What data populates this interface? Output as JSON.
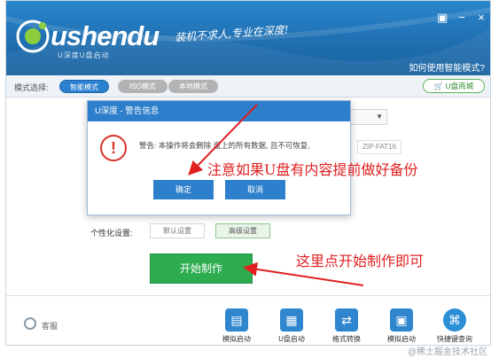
{
  "header": {
    "logo_text": "ushendu",
    "logo_sub": "U深度U盘启动",
    "slogan": "装机不求人,专业在深度!",
    "help_link": "如何使用智能模式?",
    "window_controls": [
      "skin-icon",
      "minimize-icon",
      "close-icon"
    ]
  },
  "mode_bar": {
    "label": "模式选择:",
    "modes": [
      "智能模式",
      "ISO模式",
      "本地模式"
    ],
    "shop_label": "U盘商城"
  },
  "content": {
    "fs_value": "ZIP-FAT16",
    "personal_label": "个性化设置:",
    "default_label": "默认设置",
    "advanced_label": "高级设置",
    "start_label": "开始制作"
  },
  "dialog": {
    "title": "U深度 - 警告信息",
    "message": "警告: 本操作将会删除 盘上的所有数据, 且不可恢复,",
    "ok_label": "确定",
    "cancel_label": "取消"
  },
  "annotations": {
    "note_1": "注意如果U盘有内容提前做好备份",
    "note_2": "这里点开始制作即可"
  },
  "bottom_bar": {
    "service_label": "客服",
    "tools": [
      "模拟启动",
      "U盘启动",
      "格式转换",
      "模拟启动",
      "快捷键查询"
    ]
  },
  "watermark": "@稀土掘金技术社区",
  "colors": {
    "header_blue": "#1f6fb1",
    "accent_blue": "#2d7ecb",
    "start_green": "#2eac50",
    "annotation_red": "#e02020"
  }
}
